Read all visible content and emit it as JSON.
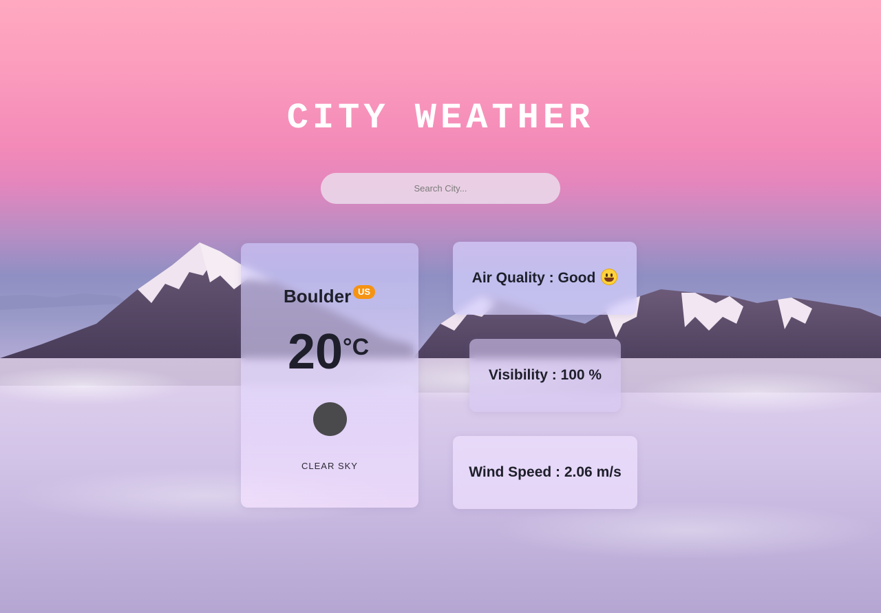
{
  "header": {
    "title": "CITY WEATHER"
  },
  "search": {
    "placeholder": "Search City...",
    "value": ""
  },
  "weather": {
    "city": "Boulder",
    "country": "US",
    "temperature": "20",
    "unit": "°C",
    "description": "CLEAR SKY",
    "icon": "weather-condition-icon"
  },
  "details": {
    "air_quality": "Air Quality : Good",
    "air_quality_emoji": "grinning-face-icon",
    "visibility": "Visibility : 100 %",
    "wind_speed": "Wind Speed : 2.06 m/s"
  },
  "colors": {
    "badge": "#f59313",
    "title_text": "#ffffff",
    "text": "#1e1f2b"
  }
}
